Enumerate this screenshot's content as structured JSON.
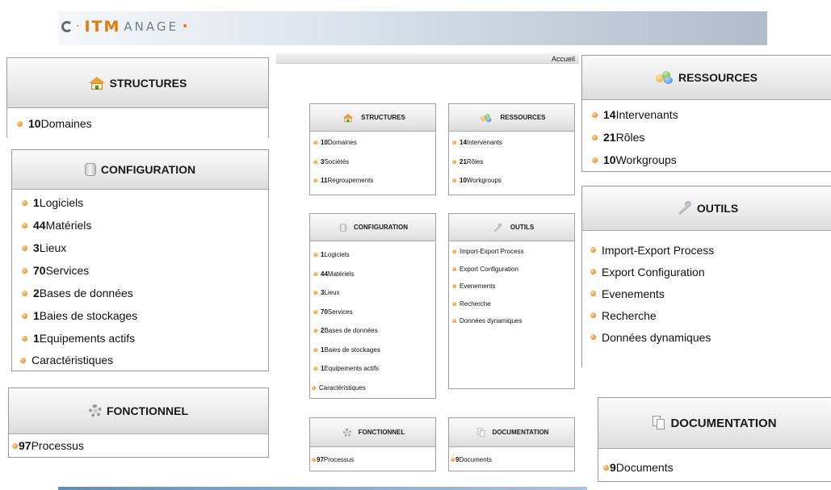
{
  "header": {
    "logo_itm": "ITM",
    "logo_rest": "ANAGE",
    "accueil": "Accueil"
  },
  "structures": {
    "title": "STRUCTURES",
    "big_items": [
      {
        "count": "10",
        "label": " Domaines"
      }
    ],
    "items": [
      {
        "count": "10",
        "label": " Domaines"
      },
      {
        "count": "3",
        "label": " Sociétés"
      },
      {
        "count": "11",
        "label": " Regroupements"
      }
    ]
  },
  "ressources": {
    "title": "RESSOURCES",
    "items": [
      {
        "count": "14",
        "label": " Intervenants"
      },
      {
        "count": "21",
        "label": " Rôles"
      },
      {
        "count": "10",
        "label": " Workgroups"
      }
    ]
  },
  "configuration": {
    "title": "CONFIGURATION",
    "items": [
      {
        "count": "1",
        "label": " Logiciels"
      },
      {
        "count": "44",
        "label": " Matériels"
      },
      {
        "count": "3",
        "label": " Lieux"
      },
      {
        "count": "70",
        "label": " Services"
      },
      {
        "count": "2",
        "label": " Bases de données"
      },
      {
        "count": "1",
        "label": " Baies de stockages"
      },
      {
        "count": "1",
        "label": " Equipements actifs"
      }
    ],
    "extra": "Caractéristiques"
  },
  "outils": {
    "title": "OUTILS",
    "items": [
      "Import-Export Process",
      "Export Configuration",
      "Evenements",
      "Recherche",
      "Données dynamiques"
    ]
  },
  "fonctionnel": {
    "title": "FONCTIONNEL",
    "count": "97",
    "label": " Processus"
  },
  "documentation": {
    "title": "DOCUMENTATION",
    "count": "9",
    "label": " Documents"
  },
  "colors": {
    "bullet": "#f09a3e",
    "logo_accent": "#e07b10",
    "logo_text": "#6b7f96"
  }
}
